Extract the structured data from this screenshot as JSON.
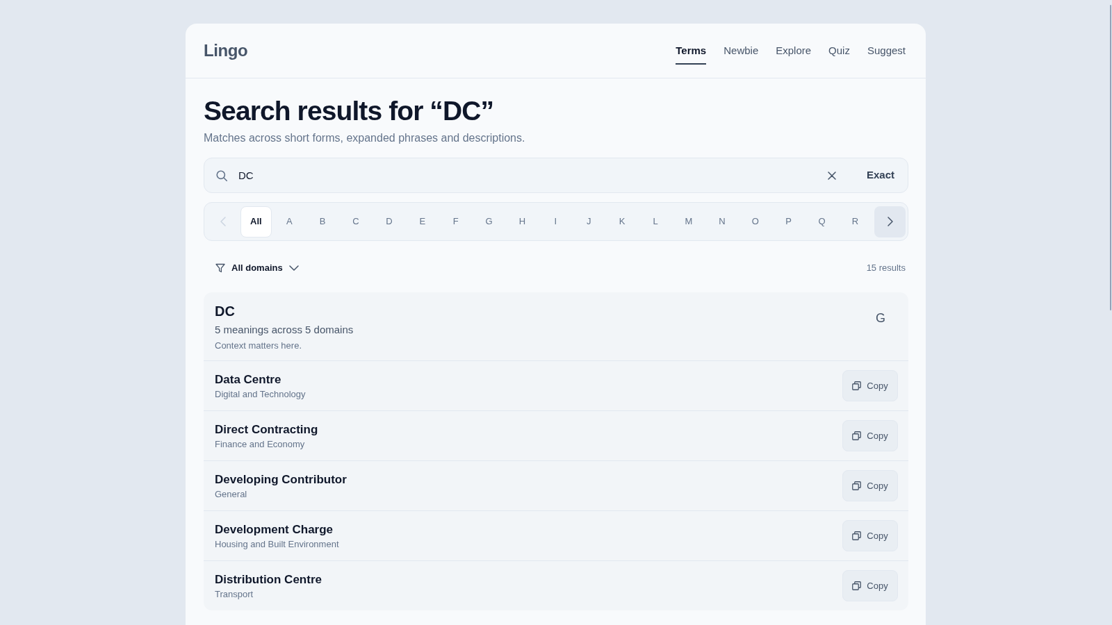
{
  "header": {
    "logo": "Lingo",
    "nav": [
      {
        "label": "Terms",
        "selected": true
      },
      {
        "label": "Newbie",
        "selected": false
      },
      {
        "label": "Explore",
        "selected": false
      },
      {
        "label": "Quiz",
        "selected": false
      },
      {
        "label": "Suggest",
        "selected": false
      }
    ]
  },
  "page": {
    "title": "Search results for “DC”",
    "subtitle": "Matches across short forms, expanded phrases and descriptions."
  },
  "search": {
    "value": "DC",
    "mode_button": "Exact"
  },
  "letters": {
    "prev": {
      "disabled": true
    },
    "next": {
      "disabled": false
    },
    "items": [
      {
        "label": "All",
        "selected": true
      },
      {
        "label": "A",
        "selected": false
      },
      {
        "label": "B",
        "selected": false
      },
      {
        "label": "C",
        "selected": false
      },
      {
        "label": "D",
        "selected": false
      },
      {
        "label": "E",
        "selected": false
      },
      {
        "label": "F",
        "selected": false
      },
      {
        "label": "G",
        "selected": false
      },
      {
        "label": "H",
        "selected": false
      },
      {
        "label": "I",
        "selected": false
      },
      {
        "label": "J",
        "selected": false
      },
      {
        "label": "K",
        "selected": false
      },
      {
        "label": "L",
        "selected": false
      },
      {
        "label": "M",
        "selected": false
      },
      {
        "label": "N",
        "selected": false
      },
      {
        "label": "O",
        "selected": false
      },
      {
        "label": "P",
        "selected": false
      },
      {
        "label": "Q",
        "selected": false
      },
      {
        "label": "R",
        "selected": false
      }
    ]
  },
  "filter": {
    "label": "All domains",
    "count": "15 results"
  },
  "term": {
    "short_form": "DC",
    "summary": "5 meanings across 5 domains",
    "note": "Context matters here.",
    "lookup_label": "G"
  },
  "meanings": [
    {
      "phrase": "Data Centre",
      "domain": "Digital and Technology",
      "copy_label": "Copy"
    },
    {
      "phrase": "Direct Contracting",
      "domain": "Finance and Economy",
      "copy_label": "Copy"
    },
    {
      "phrase": "Developing Contributor",
      "domain": "General",
      "copy_label": "Copy"
    },
    {
      "phrase": "Development Charge",
      "domain": "Housing and Built Environment",
      "copy_label": "Copy"
    },
    {
      "phrase": "Distribution Centre",
      "domain": "Transport",
      "copy_label": "Copy"
    }
  ]
}
